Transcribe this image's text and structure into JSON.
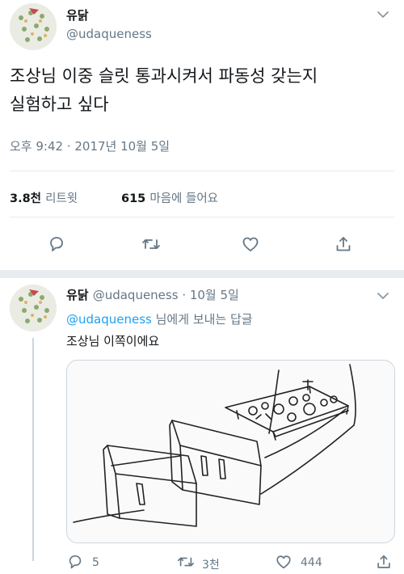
{
  "tweet": {
    "display_name": "유닭",
    "handle": "@udaqueness",
    "text_line1": "조상님 이중 슬릿 통과시켜서 파동성 갖는지",
    "text_line2": "실험하고 싶다",
    "timestamp": "오후 9:42 · 2017년 10월 5일",
    "retweets": {
      "count": "3.8천",
      "label": "리트윗"
    },
    "likes": {
      "count": "615",
      "label": "마음에 들어요"
    }
  },
  "reply": {
    "display_name": "유닭",
    "handle_date": "@udaqueness · 10월 5일",
    "reply_to_handle": "@udaqueness",
    "reply_to_suffix": " 님에게 보내는 답글",
    "text": "조상님 이쪽이에요",
    "counts": {
      "replies": "5",
      "retweets": "3천",
      "likes": "444"
    }
  },
  "icons": [
    "avatar",
    "chevron-down-icon",
    "reply-icon",
    "retweet-icon",
    "like-icon",
    "share-icon"
  ],
  "colors": {
    "link": "#1da1f2",
    "secondary_text": "#657786",
    "divider": "#e6ecf0"
  }
}
